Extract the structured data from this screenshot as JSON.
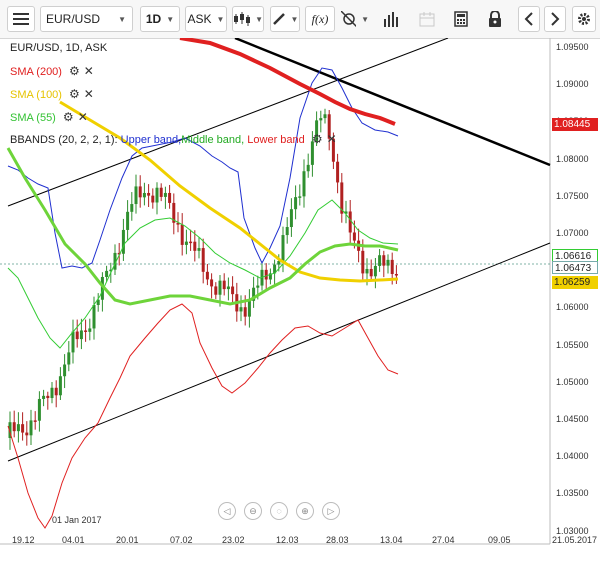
{
  "toolbar": {
    "timeframe": "1D",
    "price_side": "ASK",
    "symbol": "EUR/USD",
    "fx_label": "f(x)",
    "icons": [
      "menu-icon",
      "candles-icon",
      "pencil-icon",
      "function-icon",
      "crosshair-icon",
      "bar-volume-icon",
      "calendar-icon",
      "calculator-icon",
      "lock-icon",
      "chevron-left-icon",
      "chevron-right-icon",
      "gear-icon"
    ]
  },
  "legend": {
    "instrument": "EUR/USD, 1D, ASK",
    "sma200": "SMA (200)",
    "sma100": "SMA (100)",
    "sma55": "SMA (55)",
    "bbands_name": "BBANDS (20, 2, 2, 1):",
    "bbands_upper": "Upper band,",
    "bbands_middle": "Middle band,",
    "bbands_lower": "Lower band"
  },
  "price_tags": {
    "sma200": "1.08445",
    "bb_middle": "1.06616",
    "last_price": "1.06473",
    "sma100": "1.06259"
  },
  "colors": {
    "sma200": "#e02020",
    "sma100": "#f0d000",
    "sma55": "#6ed43a",
    "bb_upper": "#2030d0",
    "bb_middle": "#33cc33",
    "bb_lower": "#e02020",
    "bull": "#2f8f2f",
    "bear": "#b02020",
    "channel": "#000000"
  },
  "chart_data": {
    "type": "candlestick",
    "symbol": "EUR/USD",
    "interval": "1D",
    "price_scale": [
      "1.09500",
      "1.09000",
      "1.08500",
      "1.08000",
      "1.07500",
      "1.07000",
      "1.06500",
      "1.06000",
      "1.05500",
      "1.05000",
      "1.04500",
      "1.04000",
      "1.03500",
      "1.03000"
    ],
    "x_ticks": [
      "19.12",
      "04.01",
      "20.01",
      "07.02",
      "23.02",
      "12.03",
      "28.03",
      "13.04",
      "27.04",
      "09.05",
      "21.05.2017"
    ],
    "date_marker": "01 Jan 2017",
    "ylim": [
      1.0275,
      1.0965
    ]
  },
  "nav": {
    "buttons": [
      "scroll-left",
      "zoom-out",
      "reset",
      "zoom-in",
      "scroll-right"
    ]
  }
}
